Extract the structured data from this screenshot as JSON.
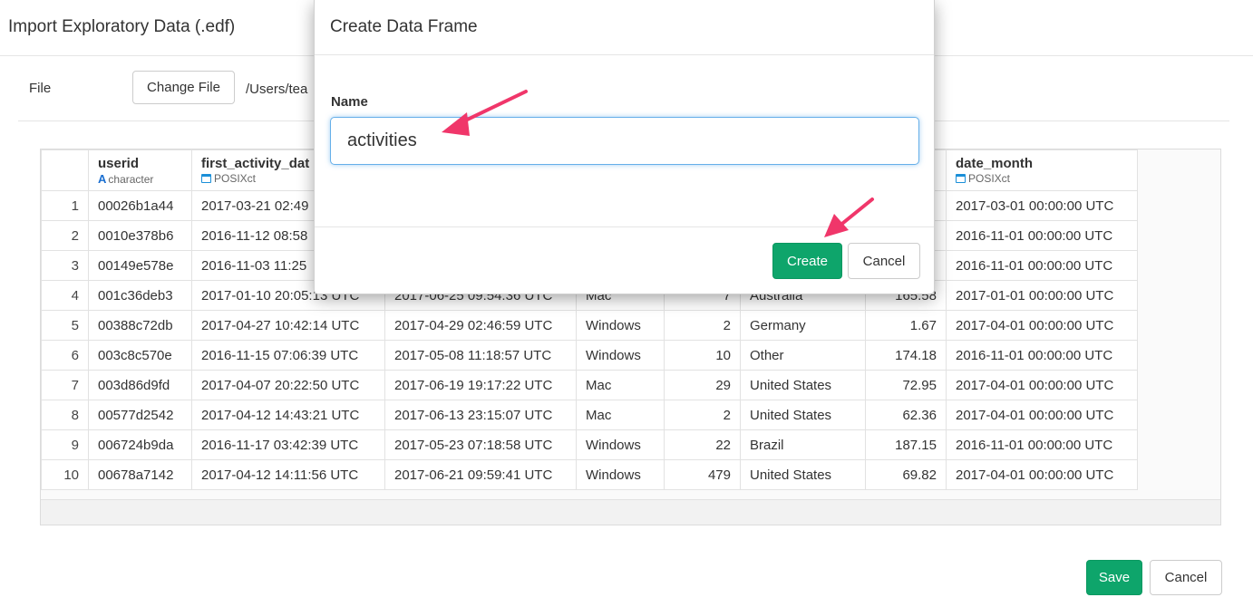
{
  "page": {
    "title": "Import Exploratory Data (.edf)",
    "file_label": "File",
    "change_file_label": "Change File",
    "file_path": "/Users/tea",
    "save_label": "Save",
    "cancel_label": "Cancel"
  },
  "table": {
    "columns": [
      {
        "name": "userid",
        "type": "character",
        "type_icon": "character-icon"
      },
      {
        "name": "first_activity_dat",
        "type": "POSIXct",
        "type_icon": "calendar-icon"
      },
      {
        "name": "",
        "type": "",
        "type_icon": ""
      },
      {
        "name": "",
        "type": "",
        "type_icon": ""
      },
      {
        "name": "",
        "type": "",
        "type_icon": ""
      },
      {
        "name": "",
        "type": "",
        "type_icon": ""
      },
      {
        "name": "",
        "type": "",
        "type_icon": ""
      },
      {
        "name": "date_month",
        "type": "POSIXct",
        "type_icon": "calendar-icon"
      }
    ],
    "rows": [
      {
        "n": "1",
        "c": [
          "00026b1a44",
          "2017-03-21 02:49",
          "",
          "",
          "",
          "",
          "",
          "2017-03-01 00:00:00 UTC"
        ]
      },
      {
        "n": "2",
        "c": [
          "0010e378b6",
          "2016-11-12 08:58",
          "",
          "",
          "",
          "",
          "",
          "2016-11-01 00:00:00 UTC"
        ]
      },
      {
        "n": "3",
        "c": [
          "00149e578e",
          "2016-11-03 11:25",
          "",
          "",
          "",
          "",
          "",
          "2016-11-01 00:00:00 UTC"
        ]
      },
      {
        "n": "4",
        "c": [
          "001c36deb3",
          "2017-01-10 20:05:13 UTC",
          "2017-06-25 09:54:36 UTC",
          "Mac",
          "7",
          "Australia",
          "165.58",
          "2017-01-01 00:00:00 UTC"
        ]
      },
      {
        "n": "5",
        "c": [
          "00388c72db",
          "2017-04-27 10:42:14 UTC",
          "2017-04-29 02:46:59 UTC",
          "Windows",
          "2",
          "Germany",
          "1.67",
          "2017-04-01 00:00:00 UTC"
        ]
      },
      {
        "n": "6",
        "c": [
          "003c8c570e",
          "2016-11-15 07:06:39 UTC",
          "2017-05-08 11:18:57 UTC",
          "Windows",
          "10",
          "Other",
          "174.18",
          "2016-11-01 00:00:00 UTC"
        ]
      },
      {
        "n": "7",
        "c": [
          "003d86d9fd",
          "2017-04-07 20:22:50 UTC",
          "2017-06-19 19:17:22 UTC",
          "Mac",
          "29",
          "United States",
          "72.95",
          "2017-04-01 00:00:00 UTC"
        ]
      },
      {
        "n": "8",
        "c": [
          "00577d2542",
          "2017-04-12 14:43:21 UTC",
          "2017-06-13 23:15:07 UTC",
          "Mac",
          "2",
          "United States",
          "62.36",
          "2017-04-01 00:00:00 UTC"
        ]
      },
      {
        "n": "9",
        "c": [
          "006724b9da",
          "2016-11-17 03:42:39 UTC",
          "2017-05-23 07:18:58 UTC",
          "Windows",
          "22",
          "Brazil",
          "187.15",
          "2016-11-01 00:00:00 UTC"
        ]
      },
      {
        "n": "10",
        "c": [
          "00678a7142",
          "2017-04-12 14:11:56 UTC",
          "2017-06-21 09:59:41 UTC",
          "Windows",
          "479",
          "United States",
          "69.82",
          "2017-04-01 00:00:00 UTC"
        ]
      }
    ]
  },
  "modal": {
    "title": "Create Data Frame",
    "name_label": "Name",
    "name_value": "activities",
    "create_label": "Create",
    "cancel_label": "Cancel"
  },
  "colors": {
    "success": "#0ea56b",
    "annotation_arrow": "#f0366a",
    "input_focus": "#66afe9"
  }
}
